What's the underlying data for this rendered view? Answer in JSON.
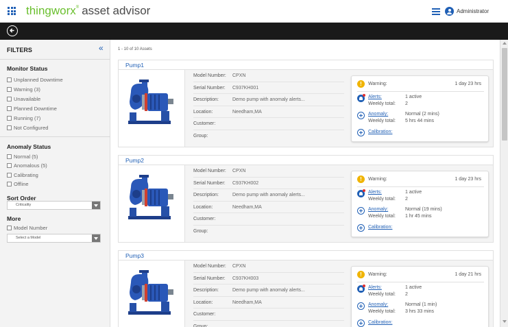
{
  "header": {
    "brand_name": "thingworx",
    "brand_mark": "®",
    "app_name": "asset advisor",
    "user_name": "Administrator"
  },
  "sidebar": {
    "title": "FILTERS",
    "collapse_glyph": "«",
    "monitor_status": {
      "title": "Monitor Status",
      "items": [
        "Unplanned Downtime",
        "Warning (3)",
        "Unavailable",
        "Planned Downtime",
        "Running (7)",
        "Not Configured"
      ]
    },
    "anomaly_status": {
      "title": "Anomaly Status",
      "items": [
        "Normal (5)",
        "Anomalous (5)",
        "Calibrating",
        "Offline"
      ]
    },
    "sort_order": {
      "title": "Sort Order",
      "selected": "Criticality"
    },
    "more": {
      "title": "More",
      "checkbox_label": "Model Number",
      "select_placeholder": "Select a Model"
    }
  },
  "main": {
    "count_text": "1 - 10 of 10 Assets",
    "labels": {
      "model_number": "Model Number:",
      "serial_number": "Serial Number:",
      "description": "Description:",
      "location": "Location:",
      "customer": "Customer:",
      "group": "Group:",
      "warning": "Warning:",
      "alerts": "Alerts:",
      "anomaly": "Anomaly:",
      "weekly_total": "Weekly total:",
      "calibration": "Calibration:"
    },
    "assets": [
      {
        "name": "Pump1",
        "model": "CPXN",
        "serial": "C937KH001",
        "description": "Demo pump with anomaly alerts...",
        "location": "Needham,MA",
        "customer": "",
        "group": "",
        "warning_duration": "1 day 23 hrs",
        "alerts_value": "1 active",
        "alerts_weekly": "2",
        "anomaly_value": "Normal (2 mins)",
        "anomaly_weekly": "5 hrs 44 mins"
      },
      {
        "name": "Pump2",
        "model": "CPXN",
        "serial": "C937KH002",
        "description": "Demo pump with anomaly alerts...",
        "location": "Needham,MA",
        "customer": "",
        "group": "",
        "warning_duration": "1 day 23 hrs",
        "alerts_value": "1 active",
        "alerts_weekly": "2",
        "anomaly_value": "Normal (19 mins)",
        "anomaly_weekly": "1 hr 45 mins"
      },
      {
        "name": "Pump3",
        "model": "CPXN",
        "serial": "C937KH003",
        "description": "Demo pump with anomaly alerts...",
        "location": "Needham,MA",
        "customer": "",
        "group": "",
        "warning_duration": "1 day 21 hrs",
        "alerts_value": "1 active",
        "alerts_weekly": "2",
        "anomaly_value": "Normal (1 min)",
        "anomaly_weekly": "3 hrs 33 mins"
      }
    ]
  },
  "colors": {
    "brand_green": "#6abf2e",
    "accent_blue": "#1f5fb5",
    "warning_yellow": "#f0b400",
    "dark_bar": "#1a1a1a"
  }
}
